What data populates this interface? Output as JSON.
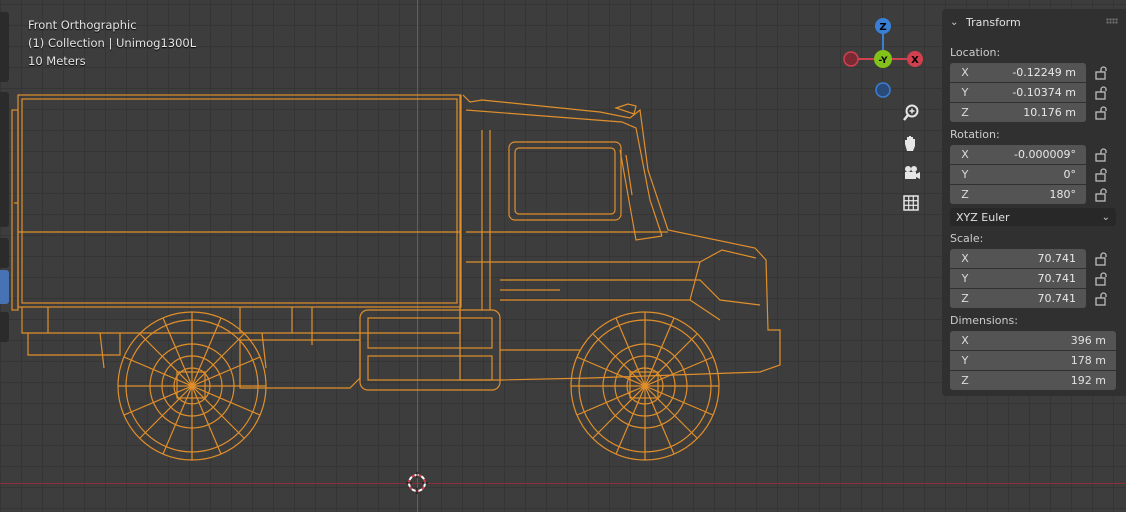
{
  "hud": {
    "view": "Front Orthographic",
    "collection": "(1) Collection | Unimog1300L",
    "scale": "10 Meters"
  },
  "gizmo": {
    "z": "Z",
    "y": "-Y",
    "x": "X"
  },
  "panel": {
    "title": "Transform",
    "location_label": "Location:",
    "location": [
      {
        "axis": "X",
        "value": "-0.12249 m"
      },
      {
        "axis": "Y",
        "value": "-0.10374 m"
      },
      {
        "axis": "Z",
        "value": "10.176 m"
      }
    ],
    "rotation_label": "Rotation:",
    "rotation": [
      {
        "axis": "X",
        "value": "-0.000009°"
      },
      {
        "axis": "Y",
        "value": "0°"
      },
      {
        "axis": "Z",
        "value": "180°"
      }
    ],
    "rotation_mode": "XYZ Euler",
    "scale_label": "Scale:",
    "scale": [
      {
        "axis": "X",
        "value": "70.741"
      },
      {
        "axis": "Y",
        "value": "70.741"
      },
      {
        "axis": "Z",
        "value": "70.741"
      }
    ],
    "dimensions_label": "Dimensions:",
    "dimensions": [
      {
        "axis": "X",
        "value": "396 m"
      },
      {
        "axis": "Y",
        "value": "178 m"
      },
      {
        "axis": "Z",
        "value": "192 m"
      }
    ]
  },
  "colors": {
    "wire": "#e08f2b",
    "axis_x": "#8a2f3a",
    "axis_z": "#3c63a8",
    "gizmo_x": "#d0404e",
    "gizmo_y": "#82c21a",
    "gizmo_z": "#3a7fd6"
  }
}
